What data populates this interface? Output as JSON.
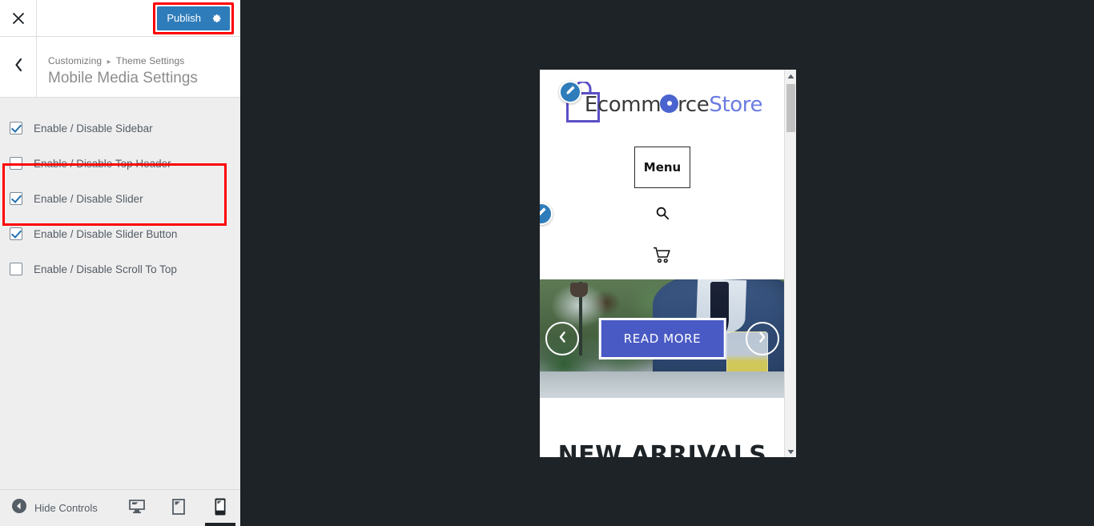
{
  "customizer": {
    "close_label": "Close",
    "close_icon": "close-icon",
    "publish_label": "Publish",
    "publish_gear_icon": "gear-icon",
    "publish_highlight_color": "#ff0000",
    "publish_bg_color": "#2e7cba",
    "back_icon": "chevron-left-icon",
    "breadcrumb": {
      "root": "Customizing",
      "separator": "▸",
      "section": "Theme Settings"
    },
    "panel_title": "Mobile Media Settings",
    "controls": [
      {
        "label": "Enable / Disable Sidebar",
        "checked": true,
        "highlighted": false
      },
      {
        "label": "Enable / Disable Top Header",
        "checked": false,
        "highlighted": false
      },
      {
        "label": "Enable / Disable Slider",
        "checked": true,
        "highlighted": true
      },
      {
        "label": "Enable / Disable Slider Button",
        "checked": true,
        "highlighted": true
      },
      {
        "label": "Enable / Disable Scroll To Top",
        "checked": false,
        "highlighted": false
      }
    ],
    "footer": {
      "hide_controls_label": "Hide Controls",
      "hide_controls_icon": "arrow-left-circle-icon",
      "devices": [
        {
          "name": "desktop",
          "icon": "desktop-icon",
          "active": false
        },
        {
          "name": "tablet",
          "icon": "tablet-icon",
          "active": false
        },
        {
          "name": "mobile",
          "icon": "mobile-icon",
          "active": true
        }
      ]
    }
  },
  "preview": {
    "device": "mobile",
    "site": {
      "logo": {
        "icon": "shopping-bag-icon",
        "part1": "Ecomm",
        "circle_letter": "o",
        "part2": "rce",
        "part3": "Store",
        "dark_color": "#3b3b3b",
        "accent_color": "#6b7ce0",
        "circle_color": "#4a63cf"
      },
      "edit_bubbles": [
        {
          "name": "edit-logo-bubble",
          "icon": "pencil-icon"
        },
        {
          "name": "edit-slider-bubble",
          "icon": "pencil-icon"
        }
      ],
      "menu_label": "Menu",
      "search_icon": "search-icon",
      "cart_icon": "shopping-cart-icon",
      "slider": {
        "prev_icon": "chevron-left-icon",
        "next_icon": "chevron-right-icon",
        "button_label": "READ MORE",
        "button_color": "#4a5ac4"
      },
      "section_heading": "NEW ARRIVALS"
    },
    "scrollbar": {
      "up_icon": "caret-up-icon",
      "down_icon": "caret-down-icon"
    }
  }
}
